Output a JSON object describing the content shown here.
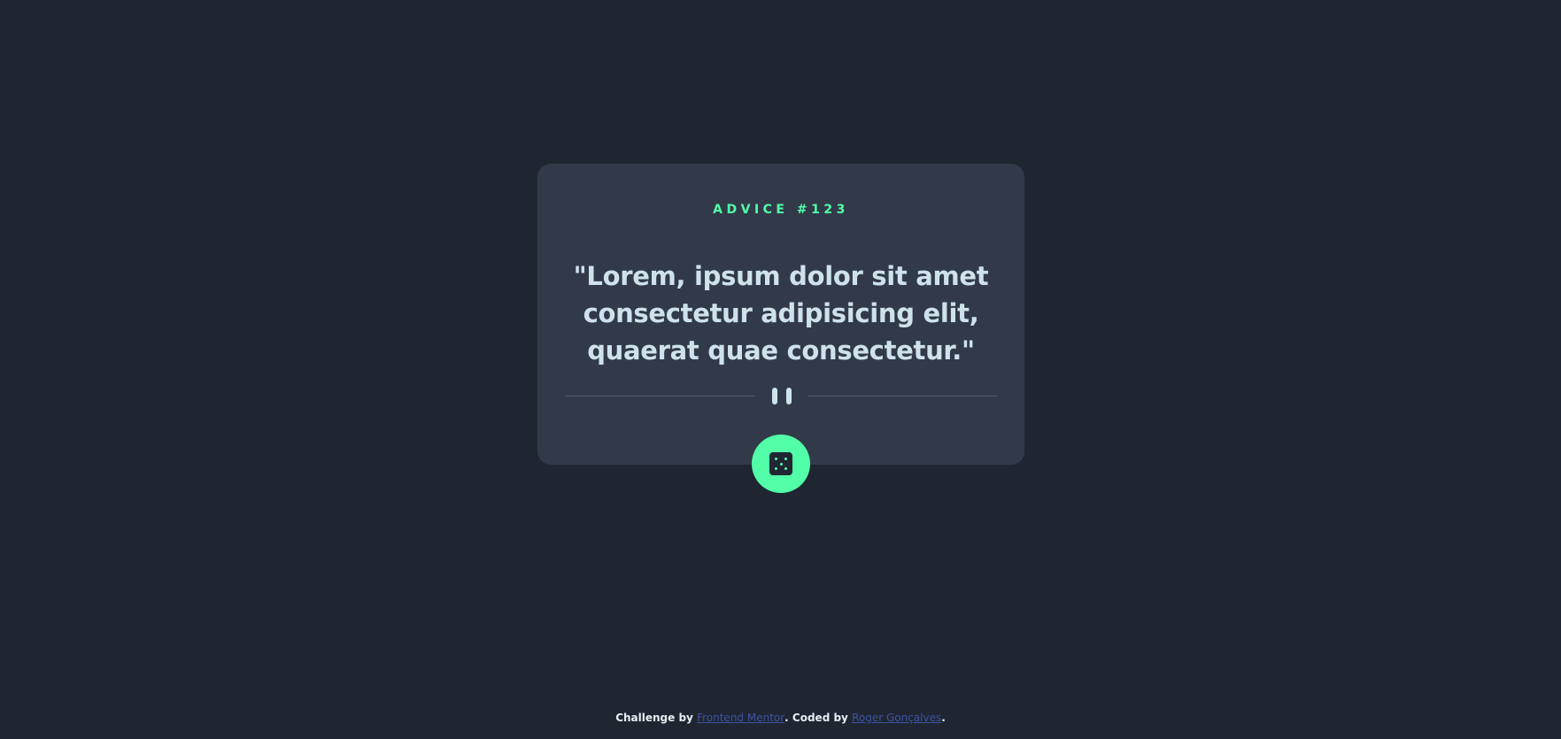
{
  "card": {
    "advice_label": "ADVICE #123",
    "advice_text": "\"Lorem, ipsum dolor sit amet consectetur adipisicing elit, quaerat quae consectetur.\""
  },
  "divider": {
    "icon": "pause-icon"
  },
  "dice_button": {
    "icon": "dice-icon"
  },
  "footer": {
    "challenge_by": "Challenge by",
    "challenge_link": "Frontend Mentor",
    "coded_by": ". Coded by",
    "coder_link": "Roger Gonçalves",
    "end": "."
  },
  "colors": {
    "background": "#1f2632",
    "card": "#323a4a",
    "accent": "#52ffa8",
    "text": "#cee3e9",
    "link": "#3e52a3"
  }
}
